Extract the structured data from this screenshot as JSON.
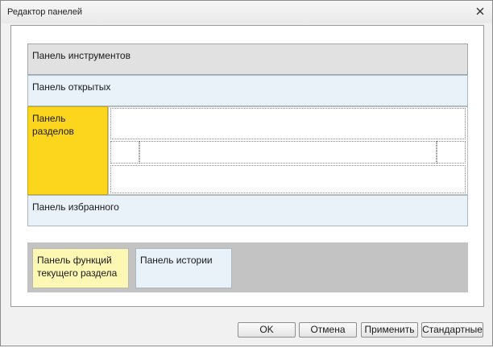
{
  "window": {
    "title": "Редактор панелей"
  },
  "panels": {
    "tools": "Панель инструментов",
    "open": "Панель открытых",
    "sections": "Панель разделов",
    "favorites": "Панель избранного",
    "functions": "Панель функций текущего раздела",
    "history": "Панель истории"
  },
  "buttons": {
    "ok": "OK",
    "cancel": "Отмена",
    "apply": "Применить",
    "defaults": "Стандартные"
  },
  "colors": {
    "sections_panel": "#fcd61c",
    "functions_panel": "#fdf7b4",
    "open_panel": "#e8f2f8",
    "tools_panel": "#e1e1e1",
    "bottom_strip": "#c3c3c3"
  },
  "icons": {
    "close": "close-icon"
  }
}
